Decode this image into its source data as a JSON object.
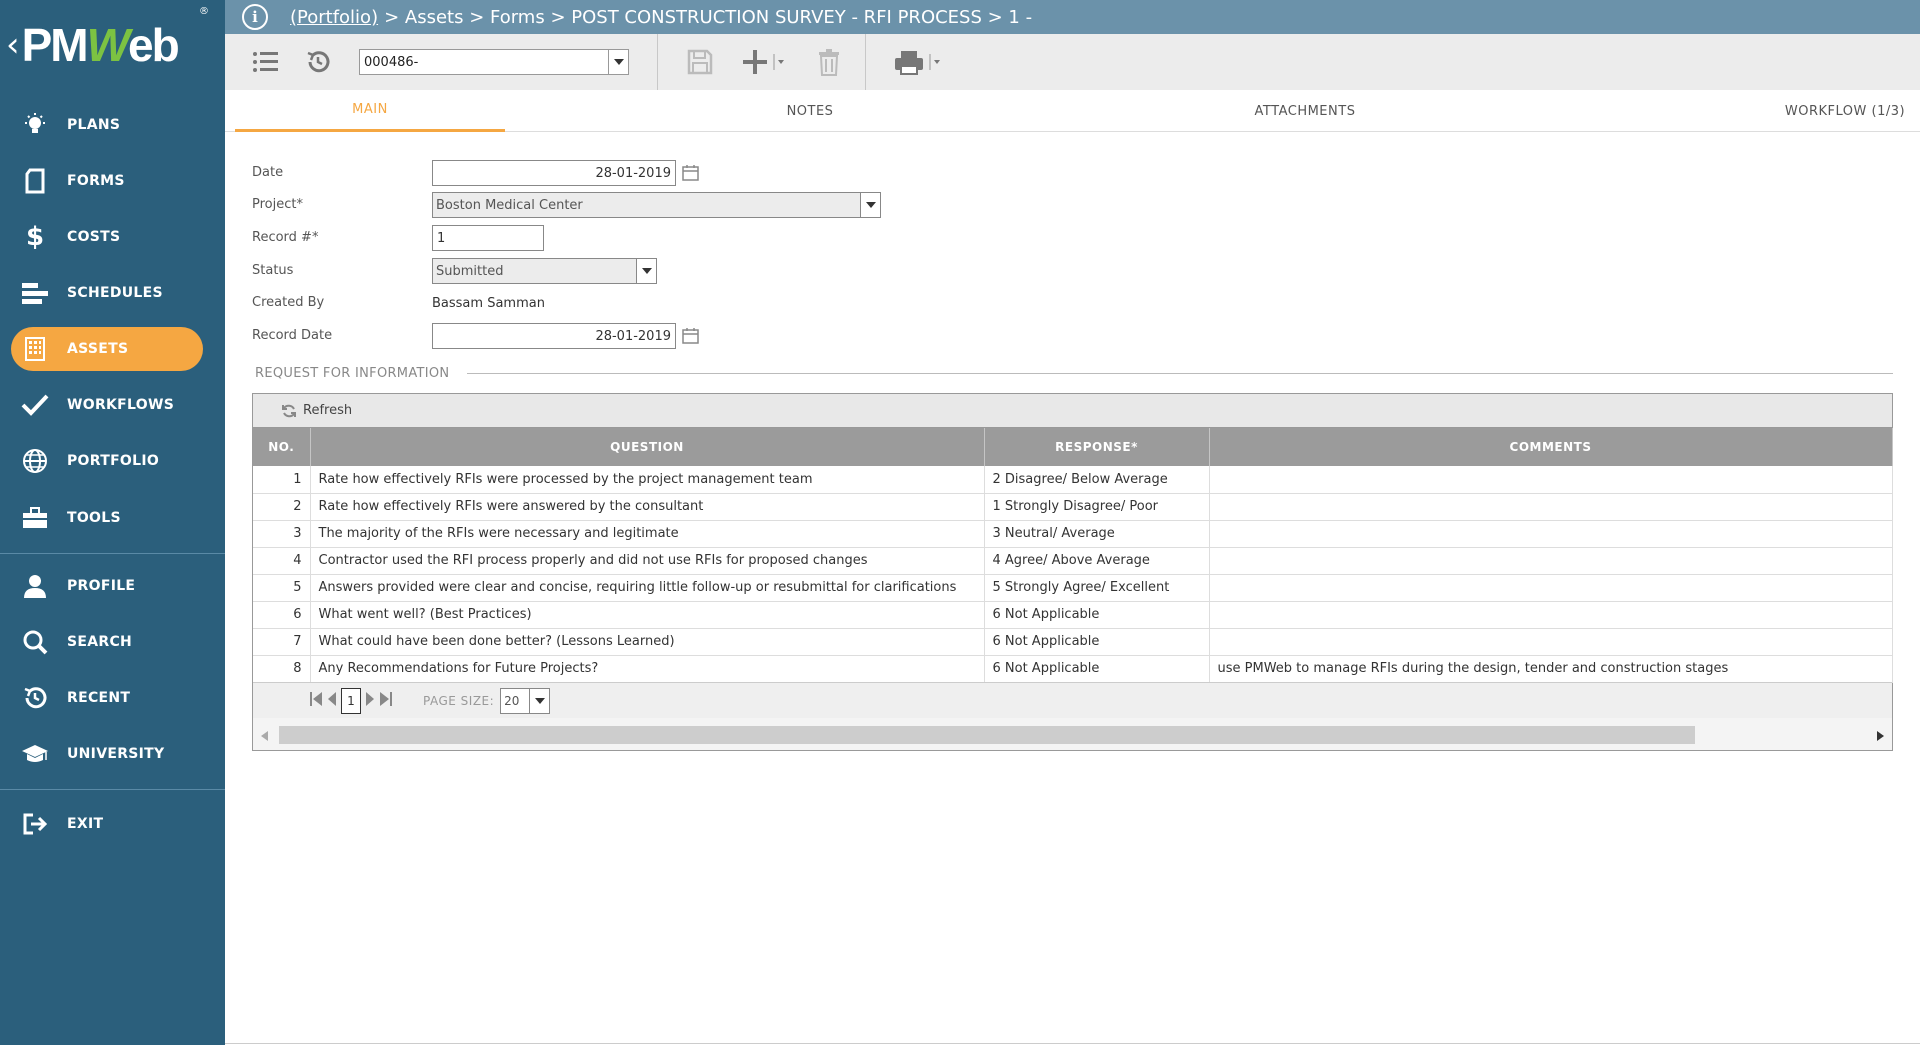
{
  "sidebar": {
    "logo_text": "PMWeb",
    "items": [
      {
        "label": "PLANS",
        "icon": "bulb-icon"
      },
      {
        "label": "FORMS",
        "icon": "document-icon"
      },
      {
        "label": "COSTS",
        "icon": "dollar-icon"
      },
      {
        "label": "SCHEDULES",
        "icon": "gantt-icon"
      },
      {
        "label": "ASSETS",
        "icon": "building-icon",
        "active": true
      },
      {
        "label": "WORKFLOWS",
        "icon": "checkmark-icon"
      },
      {
        "label": "PORTFOLIO",
        "icon": "globe-icon"
      },
      {
        "label": "TOOLS",
        "icon": "briefcase-icon"
      },
      {
        "label": "PROFILE",
        "icon": "user-icon"
      },
      {
        "label": "SEARCH",
        "icon": "search-icon"
      },
      {
        "label": "RECENT",
        "icon": "history-icon"
      },
      {
        "label": "UNIVERSITY",
        "icon": "graduation-cap-icon"
      },
      {
        "label": "EXIT",
        "icon": "exit-icon"
      }
    ]
  },
  "header": {
    "crumb_portfolio": "(Portfolio)",
    "crumb_rest": "> Assets > Forms > POST CONSTRUCTION SURVEY - RFI PROCESS > 1 -"
  },
  "toolbar": {
    "record_value": "000486-"
  },
  "tabs": [
    {
      "label": "MAIN",
      "active": true
    },
    {
      "label": "NOTES"
    },
    {
      "label": "ATTACHMENTS"
    },
    {
      "label": "WORKFLOW (1/3)"
    }
  ],
  "form": {
    "date_label": "Date",
    "date_value": "28-01-2019",
    "project_label": "Project*",
    "project_value": "Boston Medical Center",
    "record_label": "Record #*",
    "record_value": "1",
    "status_label": "Status",
    "status_value": "Submitted",
    "created_by_label": "Created By",
    "created_by_value": "Bassam Samman",
    "record_date_label": "Record Date",
    "record_date_value": "28-01-2019"
  },
  "section": {
    "title": "REQUEST FOR INFORMATION",
    "refresh_label": "Refresh"
  },
  "grid": {
    "columns": [
      "NO.",
      "QUESTION",
      "RESPONSE*",
      "COMMENTS"
    ],
    "rows": [
      {
        "no": "1",
        "question": "Rate how effectively RFIs were processed by the project management team",
        "response": "2 Disagree/ Below Average",
        "comments": ""
      },
      {
        "no": "2",
        "question": "Rate how effectively RFIs were answered by the consultant",
        "response": "1 Strongly Disagree/ Poor",
        "comments": ""
      },
      {
        "no": "3",
        "question": "The majority of the RFIs were necessary and legitimate",
        "response": "3 Neutral/ Average",
        "comments": ""
      },
      {
        "no": "4",
        "question": "Contractor used the RFI process properly and did not use RFIs for proposed changes",
        "response": "4 Agree/ Above Average",
        "comments": ""
      },
      {
        "no": "5",
        "question": "Answers provided were clear and concise, requiring little follow-up or resubmittal for clarifications",
        "response": "5 Strongly Agree/ Excellent",
        "comments": ""
      },
      {
        "no": "6",
        "question": "What went well? (Best Practices)",
        "response": "6 Not Applicable",
        "comments": ""
      },
      {
        "no": "7",
        "question": "What could have been done better? (Lessons Learned)",
        "response": "6 Not Applicable",
        "comments": ""
      },
      {
        "no": "8",
        "question": "Any Recommendations for Future Projects?",
        "response": "6 Not Applicable",
        "comments": "use PMWeb to manage RFIs during the design, tender and construction stages"
      }
    ],
    "pager": {
      "current_page": "1",
      "page_size_label": "PAGE SIZE:",
      "page_size_value": "20"
    }
  },
  "colors": {
    "sidebar_bg": "#2b5f7c",
    "header_bg": "#6b92aa",
    "accent": "#f5a742",
    "logo_green": "#7cc242"
  }
}
